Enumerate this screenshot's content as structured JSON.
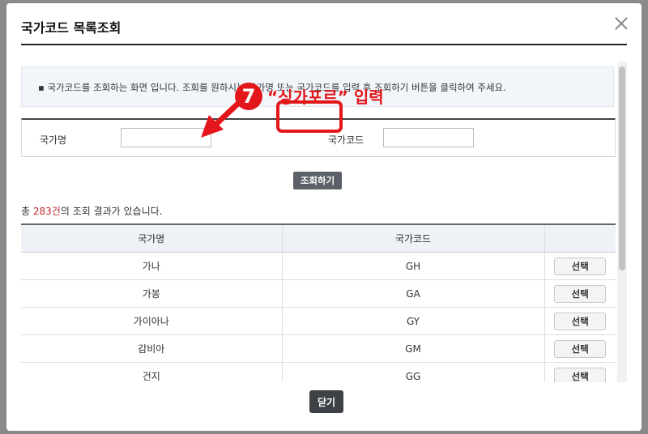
{
  "modal": {
    "title": "국가코드 목록조회",
    "close_label": "닫기"
  },
  "info": {
    "text": "▪ 국가코드를 조회하는 화면 입니다. 조회를 원하시는 국가명 또는 국가코드를 입력 후 조회하기 버튼을 클릭하여 주세요."
  },
  "search": {
    "country_name_label": "국가명",
    "country_name_value": "",
    "country_code_label": "국가코드",
    "country_code_value": "",
    "button_label": "조회하기"
  },
  "result": {
    "prefix": "총 ",
    "count": "283건",
    "suffix": "의 조회 결과가 있습니다."
  },
  "table": {
    "headers": [
      "국가명",
      "국가코드",
      ""
    ],
    "rows": [
      {
        "name": "가나",
        "code": "GH",
        "action": "선택"
      },
      {
        "name": "가봉",
        "code": "GA",
        "action": "선택"
      },
      {
        "name": "가이아나",
        "code": "GY",
        "action": "선택"
      },
      {
        "name": "감비아",
        "code": "GM",
        "action": "선택"
      },
      {
        "name": "건지",
        "code": "GG",
        "action": "선택"
      }
    ]
  },
  "annotation": {
    "step": "7",
    "text": "“싱가포르” 입력",
    "color": "#e3171b"
  }
}
